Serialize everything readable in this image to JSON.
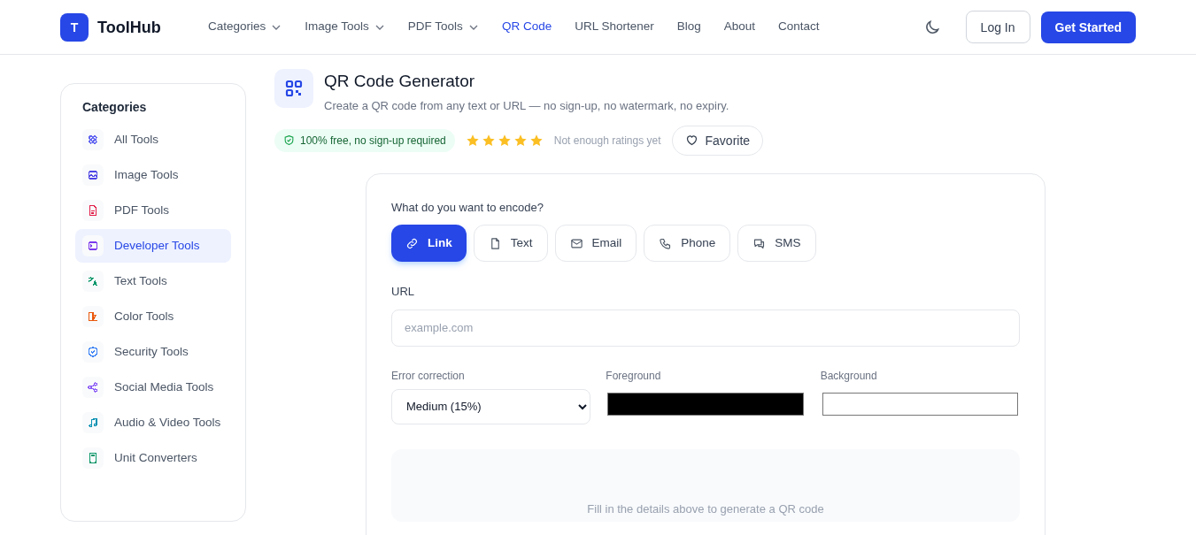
{
  "header": {
    "logo_letter": "T",
    "brand": "ToolHub",
    "nav": [
      {
        "label": "Categories",
        "dropdown": true,
        "selected": false
      },
      {
        "label": "Image Tools",
        "dropdown": true,
        "selected": false
      },
      {
        "label": "PDF Tools",
        "dropdown": true,
        "selected": false
      },
      {
        "label": "QR Code",
        "dropdown": false,
        "selected": true
      },
      {
        "label": "URL Shortener",
        "dropdown": false,
        "selected": false
      },
      {
        "label": "Blog",
        "dropdown": false,
        "selected": false
      },
      {
        "label": "About",
        "dropdown": false,
        "selected": false
      },
      {
        "label": "Contact",
        "dropdown": false,
        "selected": false
      }
    ],
    "login": "Log In",
    "cta": "Get Started"
  },
  "sidebar": {
    "title": "Categories",
    "items": [
      {
        "label": "All Tools",
        "color": "#6366f1",
        "selected": false
      },
      {
        "label": "Image Tools",
        "color": "#4f46e5",
        "selected": false
      },
      {
        "label": "PDF Tools",
        "color": "#e11d48",
        "selected": false
      },
      {
        "label": "Developer Tools",
        "color": "#7c3aed",
        "selected": true
      },
      {
        "label": "Text Tools",
        "color": "#059669",
        "selected": false
      },
      {
        "label": "Color Tools",
        "color": "#ea580c",
        "selected": false
      },
      {
        "label": "Security Tools",
        "color": "#3b82f6",
        "selected": false
      },
      {
        "label": "Social Media Tools",
        "color": "#8b5cf6",
        "selected": false
      },
      {
        "label": "Audio & Video Tools",
        "color": "#0891b2",
        "selected": false
      },
      {
        "label": "Unit Converters",
        "color": "#059669",
        "selected": false
      }
    ]
  },
  "tool": {
    "title": "QR Code Generator",
    "description": "Create a QR code from any text or URL — no sign-up, no watermark, no expiry.",
    "badge": "100% free, no sign-up required",
    "stars": 5,
    "rating_note": "Not enough ratings yet",
    "favorite": "Favorite"
  },
  "form": {
    "question": "What do you want to encode?",
    "types": [
      {
        "label": "Link",
        "selected": true
      },
      {
        "label": "Text",
        "selected": false
      },
      {
        "label": "Email",
        "selected": false
      },
      {
        "label": "Phone",
        "selected": false
      },
      {
        "label": "SMS",
        "selected": false
      }
    ],
    "url_label": "URL",
    "url_placeholder": "example.com",
    "error_label": "Error correction",
    "error_value": "Medium (15%)",
    "fg_label": "Foreground",
    "bg_label": "Background",
    "preview_hint": "Fill in the details above to generate a QR code"
  }
}
